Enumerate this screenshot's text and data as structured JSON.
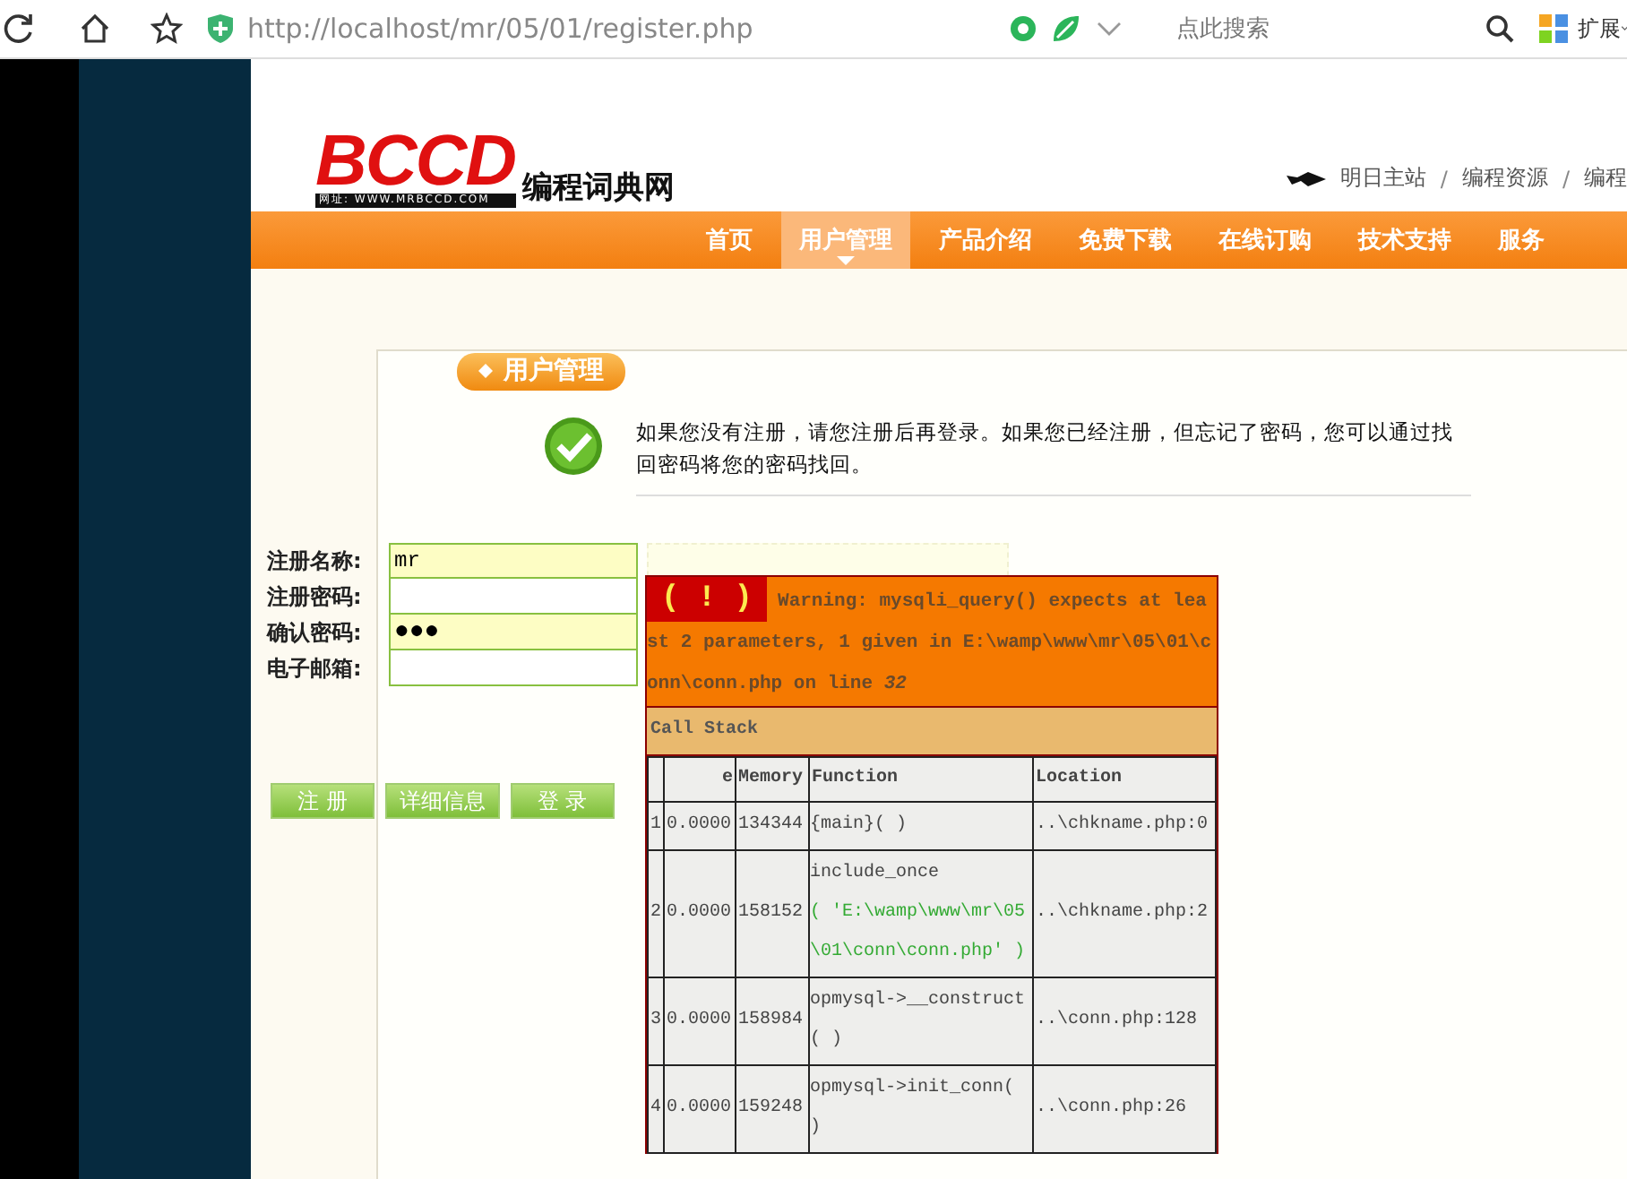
{
  "browser": {
    "url": "http://localhost/mr/05/01/register.php",
    "search": {
      "placeholder": "点此搜索"
    },
    "extensions": "扩展"
  },
  "header": {
    "logo": {
      "mark": "BCCD",
      "site_url": "网址: WWW.MRBCCD.COM",
      "name": "编程词典网"
    },
    "top_links": [
      "明日主站",
      "编程资源",
      "编程"
    ],
    "separator": "/"
  },
  "nav": [
    {
      "label": "首页",
      "selected": false
    },
    {
      "label": "用户管理",
      "selected": true
    },
    {
      "label": "产品介绍",
      "selected": false
    },
    {
      "label": "免费下载",
      "selected": false
    },
    {
      "label": "在线订购",
      "selected": false
    },
    {
      "label": "技术支持",
      "selected": false
    },
    {
      "label": "服务",
      "selected": false
    }
  ],
  "panel": {
    "title": "用户管理",
    "notice": "如果您没有注册，请您注册后再登录。如果您已经注册，但忘记了密码，您可以通过找回密码将您的密码找回。"
  },
  "form": {
    "fields": [
      {
        "label": "注册名称:",
        "value": "mr",
        "kind": "text",
        "highlighted": true
      },
      {
        "label": "注册密码:",
        "kind": "password",
        "highlighted": false
      },
      {
        "label": "确认密码:",
        "value": "●●●",
        "kind": "password",
        "highlighted": true
      },
      {
        "label": "电子邮箱:",
        "kind": "text",
        "highlighted": false
      }
    ],
    "buttons": [
      "注 册",
      "详细信息",
      "登 录"
    ]
  },
  "error": {
    "icon": "( ! )",
    "message": "Warning: mysqli_query() expects at least 2 parameters, 1 given in E:\\wamp\\www\\mr\\05\\01\\conn\\conn.php on line *32*",
    "stack_title": "Call Stack",
    "columns": [
      "e",
      "Memory",
      "Function",
      "Location"
    ],
    "rows": [
      {
        "number": "1",
        "time": "0.0000",
        "memory": "134344",
        "function": "{main}( )",
        "location": "..\\chkname.php:0"
      },
      {
        "number": "2",
        "time": "0.0000",
        "memory": "158152",
        "function": "include_once",
        "argument": "( 'E:\\wamp\\www\\mr\\05\\01\\conn\\conn.php' )",
        "location": "..\\chkname.php:2"
      },
      {
        "number": "3",
        "time": "0.0000",
        "memory": "158984",
        "function": "opmysql->__construct( )",
        "location": "..\\conn.php:128"
      },
      {
        "number": "4",
        "time": "0.0000",
        "memory": "159248",
        "function": "opmysql->init_conn( )",
        "location": "..\\conn.php:26"
      }
    ]
  }
}
